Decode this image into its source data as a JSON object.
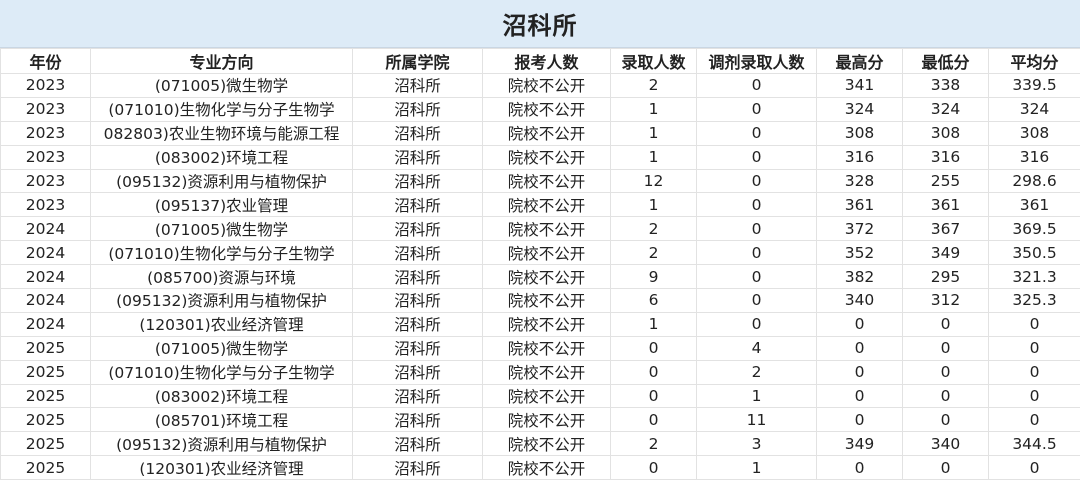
{
  "title": "沼科所",
  "headers": [
    "年份",
    "专业方向",
    "所属学院",
    "报考人数",
    "录取人数",
    "调剂录取人数",
    "最高分",
    "最低分",
    "平均分"
  ],
  "rows": [
    [
      "2023",
      "(071005)微生物学",
      "沼科所",
      "院校不公开",
      "2",
      "0",
      "341",
      "338",
      "339.5"
    ],
    [
      "2023",
      "(071010)生物化学与分子生物学",
      "沼科所",
      "院校不公开",
      "1",
      "0",
      "324",
      "324",
      "324"
    ],
    [
      "2023",
      "082803)农业生物环境与能源工程",
      "沼科所",
      "院校不公开",
      "1",
      "0",
      "308",
      "308",
      "308"
    ],
    [
      "2023",
      "(083002)环境工程",
      "沼科所",
      "院校不公开",
      "1",
      "0",
      "316",
      "316",
      "316"
    ],
    [
      "2023",
      "(095132)资源利用与植物保护",
      "沼科所",
      "院校不公开",
      "12",
      "0",
      "328",
      "255",
      "298.6"
    ],
    [
      "2023",
      "(095137)农业管理",
      "沼科所",
      "院校不公开",
      "1",
      "0",
      "361",
      "361",
      "361"
    ],
    [
      "2024",
      "(071005)微生物学",
      "沼科所",
      "院校不公开",
      "2",
      "0",
      "372",
      "367",
      "369.5"
    ],
    [
      "2024",
      "(071010)生物化学与分子生物学",
      "沼科所",
      "院校不公开",
      "2",
      "0",
      "352",
      "349",
      "350.5"
    ],
    [
      "2024",
      "(085700)资源与环境",
      "沼科所",
      "院校不公开",
      "9",
      "0",
      "382",
      "295",
      "321.3"
    ],
    [
      "2024",
      "(095132)资源利用与植物保护",
      "沼科所",
      "院校不公开",
      "6",
      "0",
      "340",
      "312",
      "325.3"
    ],
    [
      "2024",
      "(120301)农业经济管理",
      "沼科所",
      "院校不公开",
      "1",
      "0",
      "0",
      "0",
      "0"
    ],
    [
      "2025",
      "(071005)微生物学",
      "沼科所",
      "院校不公开",
      "0",
      "4",
      "0",
      "0",
      "0"
    ],
    [
      "2025",
      "(071010)生物化学与分子生物学",
      "沼科所",
      "院校不公开",
      "0",
      "2",
      "0",
      "0",
      "0"
    ],
    [
      "2025",
      "(083002)环境工程",
      "沼科所",
      "院校不公开",
      "0",
      "1",
      "0",
      "0",
      "0"
    ],
    [
      "2025",
      "(085701)环境工程",
      "沼科所",
      "院校不公开",
      "0",
      "11",
      "0",
      "0",
      "0"
    ],
    [
      "2025",
      "(095132)资源利用与植物保护",
      "沼科所",
      "院校不公开",
      "2",
      "3",
      "349",
      "340",
      "344.5"
    ],
    [
      "2025",
      "(120301)农业经济管理",
      "沼科所",
      "院校不公开",
      "0",
      "1",
      "0",
      "0",
      "0"
    ]
  ]
}
